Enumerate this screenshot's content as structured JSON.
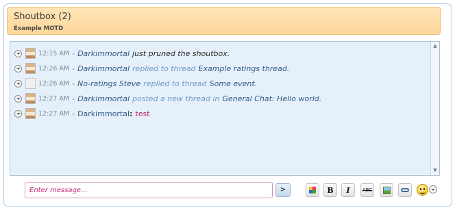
{
  "header": {
    "title": "Shoutbox (2)",
    "subtitle": "Example MOTD"
  },
  "messages": [
    {
      "time": "12:15 AM",
      "sep": "-",
      "user": "Darkimmortal",
      "text": "just pruned the shoutbox.",
      "avatar": "user-avatar"
    },
    {
      "time": "12:26 AM",
      "sep": "-",
      "user": "Darkimmortal",
      "action": "replied to thread",
      "object": "Example ratings thread.",
      "avatar": "user-avatar"
    },
    {
      "time": "12:26 AM",
      "sep": "-",
      "user": "No-ratings Steve",
      "action": "replied to thread",
      "object": "Some event.",
      "avatar": "blank-avatar"
    },
    {
      "time": "12:27 AM",
      "sep": "-",
      "user": "Darkimmortal",
      "action": "posted a new thread in",
      "object": "General Chat: Hello world.",
      "avatar": "user-avatar"
    },
    {
      "time": "12:27 AM",
      "sep": "-",
      "user": "Darkimmortal",
      "colon": ":",
      "message": "test",
      "avatar": "user-avatar"
    }
  ],
  "input": {
    "placeholder": "Enter message..."
  },
  "toolbar": {
    "send_label": ">",
    "bold_label": "B",
    "italic_label": "I",
    "strike_label": "ABC"
  },
  "colors": {
    "header_bg": "#fdd69a",
    "message_bg": "#e6f0fa",
    "user_link": "#2f5c86",
    "action_text": "#6d9cc5",
    "message_text": "#c2226f"
  }
}
